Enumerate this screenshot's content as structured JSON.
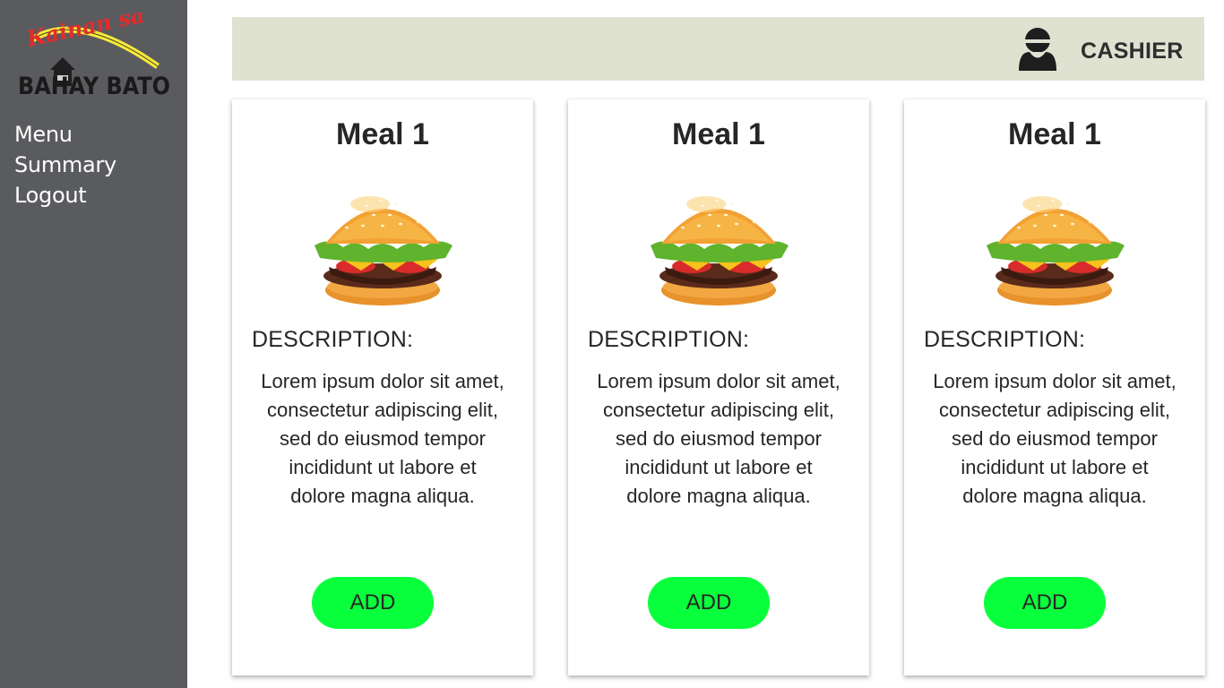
{
  "sidebar": {
    "logo": {
      "script_text": "Kainan sa",
      "main_text": "BAHAY BATO"
    },
    "items": [
      {
        "label": "Menu"
      },
      {
        "label": "Summary"
      },
      {
        "label": "Logout"
      }
    ]
  },
  "header": {
    "user_icon": "person-icon",
    "role": "CASHIER"
  },
  "meals": [
    {
      "title": "Meal 1",
      "image": "burger-image",
      "description_label": "DESCRIPTION:",
      "description": "Lorem ipsum dolor sit amet, consectetur adipiscing elit, sed do eiusmod tempor incididunt ut labore et dolore magna aliqua.",
      "button_label": "ADD"
    },
    {
      "title": "Meal 1",
      "image": "burger-image",
      "description_label": "DESCRIPTION:",
      "description": "Lorem ipsum dolor sit amet, consectetur adipiscing elit, sed do eiusmod tempor incididunt ut labore et dolore magna aliqua.",
      "button_label": "ADD"
    },
    {
      "title": "Meal 1",
      "image": "burger-image",
      "description_label": "DESCRIPTION:",
      "description": "Lorem ipsum dolor sit amet, consectetur adipiscing elit, sed do eiusmod tempor incididunt ut labore et dolore magna aliqua.",
      "button_label": "ADD"
    }
  ],
  "colors": {
    "sidebar_bg": "#5a5b5f",
    "topbar_bg": "#e0e2d1",
    "add_button": "#08ff3c",
    "logo_yellow": "#f7ea37",
    "logo_red": "#e52b2b"
  }
}
